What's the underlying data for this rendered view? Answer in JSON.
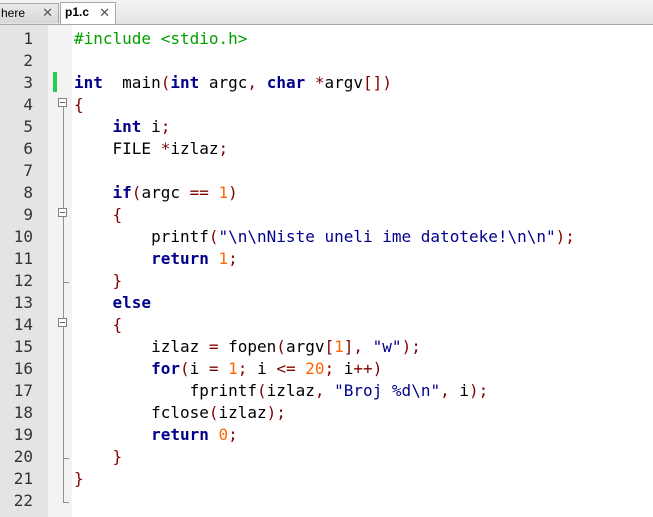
{
  "tabs": [
    {
      "label": "here",
      "close": "✕"
    },
    {
      "label": "p1.c",
      "close": "✕"
    }
  ],
  "lines": [
    {
      "n": "1",
      "t": [
        [
          "pp",
          "#include <stdio.h>"
        ]
      ]
    },
    {
      "n": "2",
      "t": []
    },
    {
      "n": "3",
      "t": [
        [
          "kw",
          "int"
        ],
        [
          "",
          "  main"
        ],
        [
          "op",
          "("
        ],
        [
          "kw",
          "int"
        ],
        [
          "",
          " argc"
        ],
        [
          "op",
          ","
        ],
        [
          "",
          ""
        ],
        [
          "kw",
          " char"
        ],
        [
          "",
          " "
        ],
        [
          "op",
          "*"
        ],
        [
          "",
          "argv"
        ],
        [
          "op",
          "[])"
        ]
      ]
    },
    {
      "n": "4",
      "t": [
        [
          "op",
          "{"
        ]
      ]
    },
    {
      "n": "5",
      "t": [
        [
          "",
          "    "
        ],
        [
          "kw",
          "int"
        ],
        [
          "",
          " i"
        ],
        [
          "op",
          ";"
        ]
      ]
    },
    {
      "n": "6",
      "t": [
        [
          "",
          "    FILE "
        ],
        [
          "op",
          "*"
        ],
        [
          "",
          "izlaz"
        ],
        [
          "op",
          ";"
        ]
      ]
    },
    {
      "n": "7",
      "t": []
    },
    {
      "n": "8",
      "t": [
        [
          "",
          "    "
        ],
        [
          "kw",
          "if"
        ],
        [
          "op",
          "("
        ],
        [
          "",
          "argc "
        ],
        [
          "op",
          "=="
        ],
        [
          "",
          " "
        ],
        [
          "num",
          "1"
        ],
        [
          "op",
          ")"
        ]
      ]
    },
    {
      "n": "9",
      "t": [
        [
          "",
          "    "
        ],
        [
          "op",
          "{"
        ]
      ]
    },
    {
      "n": "10",
      "t": [
        [
          "",
          "        printf"
        ],
        [
          "op",
          "("
        ],
        [
          "str",
          "\"\\n\\nNiste uneli ime datoteke!\\n\\n\""
        ],
        [
          "op",
          ");"
        ]
      ]
    },
    {
      "n": "11",
      "t": [
        [
          "",
          "        "
        ],
        [
          "kw",
          "return"
        ],
        [
          "",
          " "
        ],
        [
          "num",
          "1"
        ],
        [
          "op",
          ";"
        ]
      ]
    },
    {
      "n": "12",
      "t": [
        [
          "",
          "    "
        ],
        [
          "op",
          "}"
        ]
      ]
    },
    {
      "n": "13",
      "t": [
        [
          "",
          "    "
        ],
        [
          "kw",
          "else"
        ]
      ]
    },
    {
      "n": "14",
      "t": [
        [
          "",
          "    "
        ],
        [
          "op",
          "{"
        ]
      ]
    },
    {
      "n": "15",
      "t": [
        [
          "",
          "        izlaz "
        ],
        [
          "op",
          "="
        ],
        [
          "",
          " fopen"
        ],
        [
          "op",
          "("
        ],
        [
          "",
          "argv"
        ],
        [
          "op",
          "["
        ],
        [
          "num",
          "1"
        ],
        [
          "op",
          "],"
        ],
        [
          "",
          " "
        ],
        [
          "str",
          "\"w\""
        ],
        [
          "op",
          ");"
        ]
      ]
    },
    {
      "n": "16",
      "t": [
        [
          "",
          "        "
        ],
        [
          "kw",
          "for"
        ],
        [
          "op",
          "("
        ],
        [
          "",
          "i "
        ],
        [
          "op",
          "="
        ],
        [
          "",
          " "
        ],
        [
          "num",
          "1"
        ],
        [
          "op",
          ";"
        ],
        [
          "",
          " i "
        ],
        [
          "op",
          "<="
        ],
        [
          "",
          " "
        ],
        [
          "num",
          "20"
        ],
        [
          "op",
          ";"
        ],
        [
          "",
          " i"
        ],
        [
          "op",
          "++)"
        ]
      ]
    },
    {
      "n": "17",
      "t": [
        [
          "",
          "            fprintf"
        ],
        [
          "op",
          "("
        ],
        [
          "",
          "izlaz"
        ],
        [
          "op",
          ","
        ],
        [
          "",
          " "
        ],
        [
          "str",
          "\"Broj %d\\n\""
        ],
        [
          "op",
          ","
        ],
        [
          "",
          " i"
        ],
        [
          "op",
          ");"
        ]
      ]
    },
    {
      "n": "18",
      "t": [
        [
          "",
          "        fclose"
        ],
        [
          "op",
          "("
        ],
        [
          "",
          "izlaz"
        ],
        [
          "op",
          ");"
        ]
      ]
    },
    {
      "n": "19",
      "t": [
        [
          "",
          "        "
        ],
        [
          "kw",
          "return"
        ],
        [
          "",
          " "
        ],
        [
          "num",
          "0"
        ],
        [
          "op",
          ";"
        ]
      ]
    },
    {
      "n": "20",
      "t": [
        [
          "",
          "    "
        ],
        [
          "op",
          "}"
        ]
      ]
    },
    {
      "n": "21",
      "t": [
        [
          "op",
          "}"
        ]
      ]
    },
    {
      "n": "22",
      "t": []
    }
  ]
}
